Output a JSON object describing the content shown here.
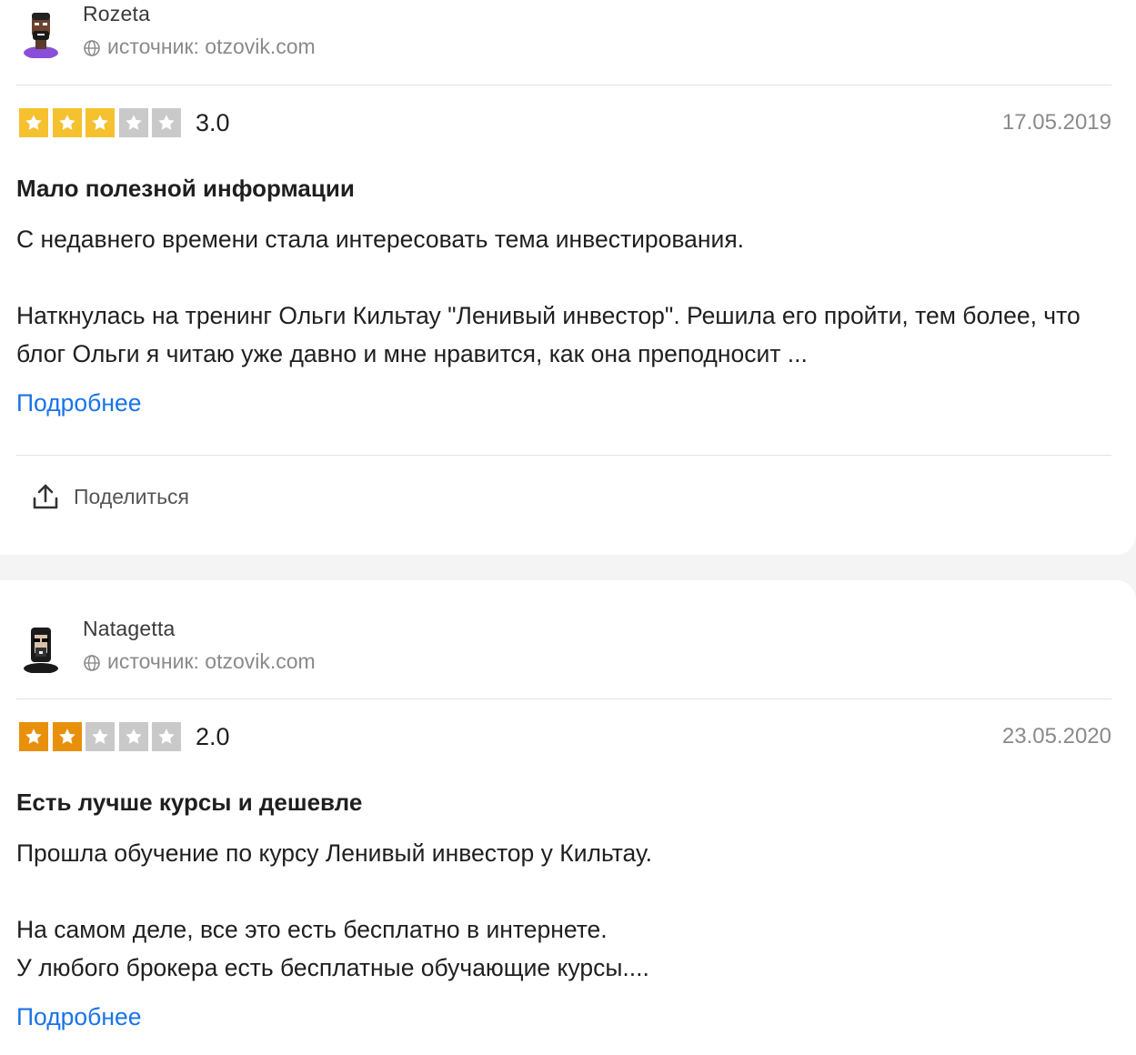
{
  "reviews": [
    {
      "author": "Rozeta",
      "source_label": "источник: otzovik.com",
      "rating_text": "3.0",
      "rating": 3,
      "date": "17.05.2019",
      "title": "Мало полезной информации",
      "body": "С недавнего времени стала интересовать тема инвестирования.\n\nНаткнулась на тренинг Ольги Кильтау \"Ленивый инвестор\". Решила его пройти, тем более, что блог Ольги я читаю уже давно и мне нравится, как она преподносит ...",
      "more_label": "Подробнее",
      "share_label": "Поделиться",
      "star_color": "#f5c12e"
    },
    {
      "author": "Natagetta",
      "source_label": "источник: otzovik.com",
      "rating_text": "2.0",
      "rating": 2,
      "date": "23.05.2020",
      "title": "Есть лучше курсы и дешевле",
      "body": "Прошла обучение по курсу Ленивый инвестор у Кильтау.\n\nНа самом деле, все это есть бесплатно в интернете.\nУ любого брокера есть бесплатные обучающие курсы....",
      "more_label": "Подробнее",
      "star_color": "#e8900c"
    }
  ],
  "colors": {
    "empty_star": "#c9c9c9",
    "link": "#1a73e8"
  }
}
